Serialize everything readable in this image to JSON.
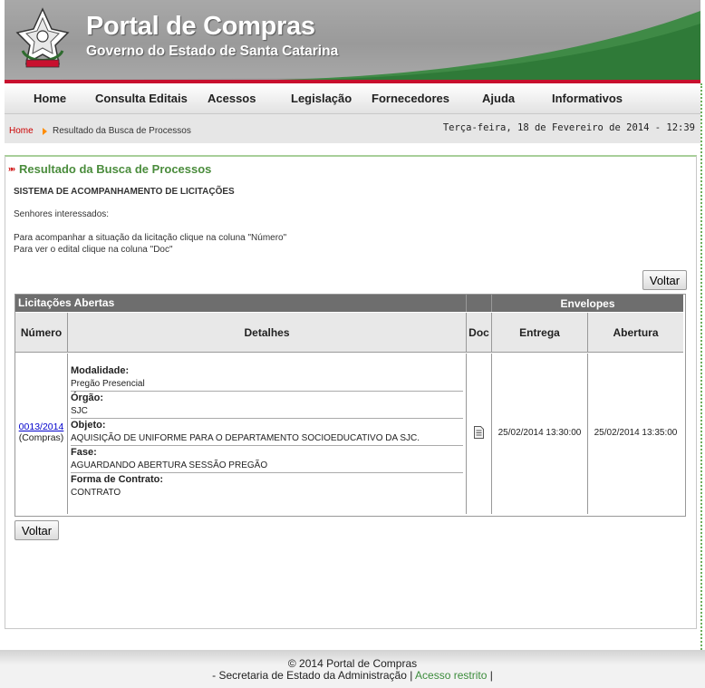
{
  "header": {
    "title": "Portal de Compras",
    "subtitle": "Governo do Estado de Santa Catarina"
  },
  "nav": [
    "Home",
    "Consulta Editais",
    "Acessos",
    "Legislação",
    "Fornecedores",
    "Ajuda",
    "Informativos"
  ],
  "breadcrumb": {
    "home": "Home",
    "current": "Resultado da Busca de Processos"
  },
  "datetime": "Terça-feira, 18 de Fevereiro de 2014 - 12:39",
  "page": {
    "title": "Resultado da Busca de Processos",
    "system_name": "SISTEMA DE ACOMPANHAMENTO DE LICITAÇÕES",
    "greeting": "Senhores interessados:",
    "instruction_1": "Para acompanhar a situação da licitação clique na coluna \"Número\"",
    "instruction_2": "Para ver o edital clique na coluna \"Doc\"",
    "voltar_label": "Voltar"
  },
  "table": {
    "title": "Licitações Abertas",
    "group_header": "Envelopes",
    "columns": {
      "numero": "Número",
      "detalhes": "Detalhes",
      "doc": "Doc",
      "entrega": "Entrega",
      "abertura": "Abertura"
    },
    "rows": [
      {
        "numero": "0013/2014",
        "orgao_tipo": "(Compras)",
        "details": [
          {
            "label": "Modalidade:",
            "value": "Pregão Presencial"
          },
          {
            "label": "Órgão:",
            "value": "SJC"
          },
          {
            "label": "Objeto:",
            "value": "AQUISIÇÃO DE UNIFORME PARA O DEPARTAMENTO SOCIOEDUCATIVO DA SJC."
          },
          {
            "label": "Fase:",
            "value": "AGUARDANDO ABERTURA SESSÃO PREGÃO"
          },
          {
            "label": "Forma de Contrato:",
            "value": "CONTRATO"
          }
        ],
        "doc_icon": "document-icon",
        "entrega": "25/02/2014 13:30:00",
        "abertura": "25/02/2014 13:35:00"
      }
    ]
  },
  "footer": {
    "copyright": "© 2014 Portal de Compras",
    "secretaria": "- Secretaria de Estado da Administração |",
    "restrito": "Acesso restrito",
    "end": "|"
  },
  "colors": {
    "accent_green": "#4a8c3c",
    "header_red": "#c8102e",
    "link_blue": "#0000cc"
  }
}
